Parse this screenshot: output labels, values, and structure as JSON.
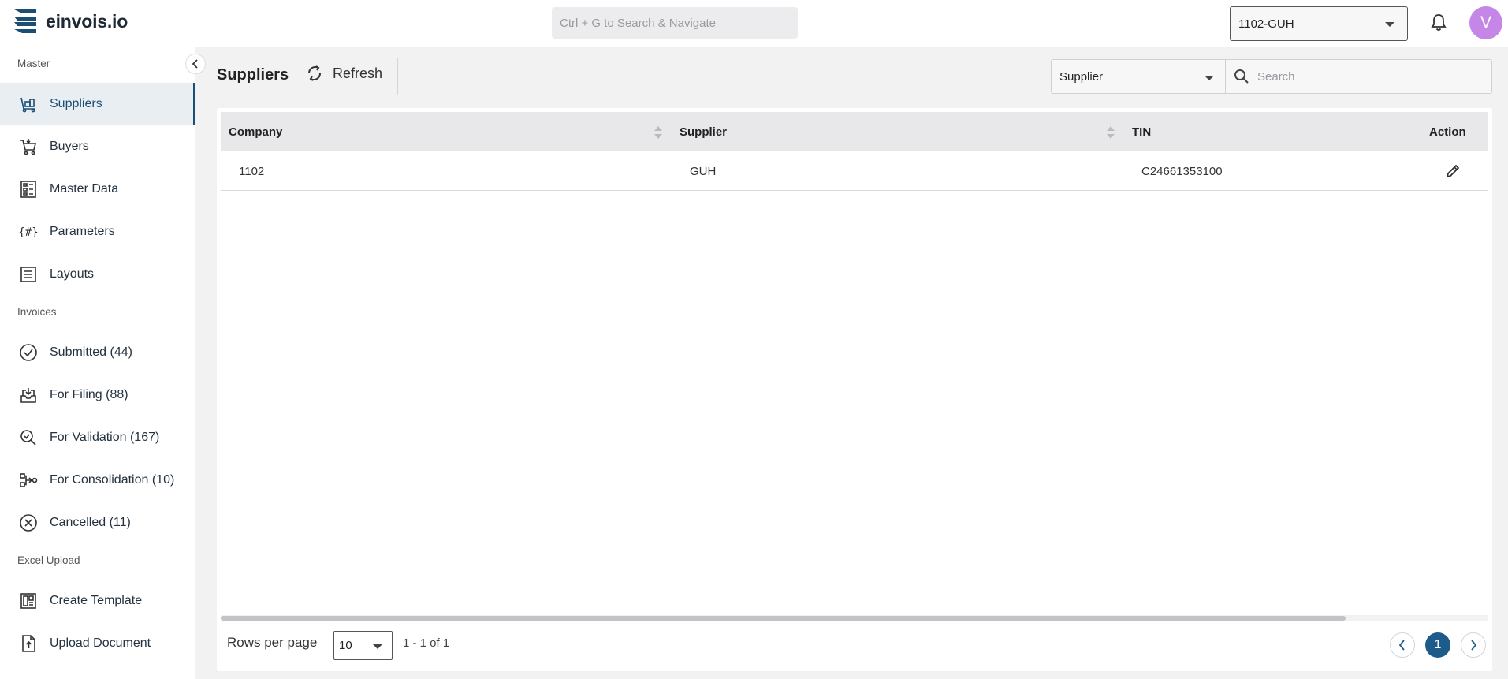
{
  "app": {
    "brand": "einvois.io",
    "search_placeholder": "Ctrl + G to Search & Navigate",
    "company_selected": "1102-GUH",
    "avatar_initial": "V",
    "avatar_color": "#c487e8",
    "accent_color": "#1c4e74"
  },
  "sidebar": {
    "sections": {
      "master": "Master",
      "invoices": "Invoices",
      "excel_upload": "Excel Upload"
    },
    "items": [
      {
        "label": "Suppliers",
        "icon": "suppliers-icon",
        "active": true
      },
      {
        "label": "Buyers",
        "icon": "cart-icon"
      },
      {
        "label": "Master Data",
        "icon": "master-data-icon"
      },
      {
        "label": "Parameters",
        "icon": "parameters-icon"
      },
      {
        "label": "Layouts",
        "icon": "layouts-icon"
      },
      {
        "label": "Submitted (44)",
        "icon": "check-circle-icon"
      },
      {
        "label": "For Filing (88)",
        "icon": "inbox-icon"
      },
      {
        "label": "For Validation (167)",
        "icon": "search-check-icon"
      },
      {
        "label": "For Consolidation (10)",
        "icon": "consolidation-icon"
      },
      {
        "label": "Cancelled (11)",
        "icon": "x-circle-icon"
      },
      {
        "label": "Create Template",
        "icon": "template-icon"
      },
      {
        "label": "Upload Document",
        "icon": "upload-icon"
      }
    ]
  },
  "main": {
    "title": "Suppliers",
    "refresh_label": "Refresh",
    "filter_field": "Supplier",
    "search_placeholder": "Search",
    "table": {
      "columns": [
        "Company",
        "Supplier",
        "TIN",
        "Action"
      ],
      "rows": [
        {
          "company": "1102",
          "supplier": "GUH",
          "tin": "C24661353100"
        }
      ]
    },
    "pagination": {
      "rows_per_page_label": "Rows per page",
      "rows_per_page": "10",
      "range": "1 - 1 of 1",
      "current_page": "1"
    }
  }
}
